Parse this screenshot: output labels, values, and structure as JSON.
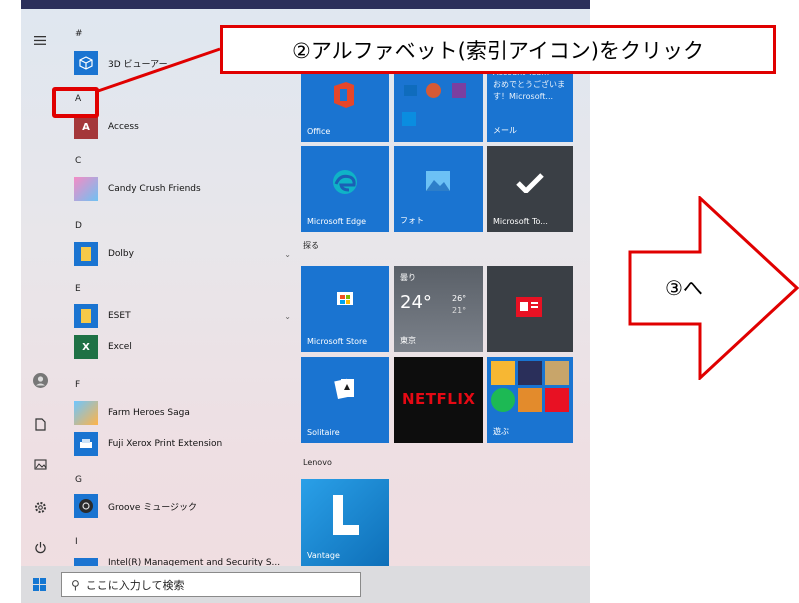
{
  "callout": {
    "text": "②アルファベット(索引アイコン)をクリック",
    "border_color": "#e00000"
  },
  "next_arrow": {
    "text": "③へ",
    "border_color": "#e00000"
  },
  "start_menu": {
    "rail_icons": [
      "hamburger-menu-icon",
      "user-account-icon",
      "documents-icon",
      "pictures-icon",
      "settings-icon",
      "power-icon"
    ],
    "app_list": {
      "headers": [
        "#",
        "A",
        "C",
        "D",
        "E",
        "F",
        "G",
        "I"
      ],
      "apps": [
        {
          "label": "3D ビューアー",
          "icon": "3d-viewer-icon"
        },
        {
          "label": "Access",
          "icon": "access-icon"
        },
        {
          "label": "Candy Crush Friends",
          "icon": "candy-crush-icon"
        },
        {
          "label": "Dolby",
          "icon": "folder-icon"
        },
        {
          "label": "ESET",
          "icon": "folder-icon"
        },
        {
          "label": "Excel",
          "icon": "excel-icon"
        },
        {
          "label": "Farm Heroes Saga",
          "icon": "farm-heroes-icon"
        },
        {
          "label": "Fuji Xerox Print Extension",
          "icon": "fuji-xerox-icon"
        },
        {
          "label": "Groove ミュージック",
          "icon": "groove-music-icon"
        },
        {
          "label": "Intel(R) Management and Security S...",
          "icon": "intel-icon"
        }
      ]
    },
    "tiles": {
      "office": "Office",
      "mail": "メール",
      "mail_notice": [
        "Account Team",
        "おめでとうございま",
        "す！Microsoft..."
      ],
      "edge": "Microsoft Edge",
      "photos": "フォト",
      "todo": "Microsoft To...",
      "group_explore": "探る",
      "store": "Microsoft Store",
      "weather_condition": "曇り",
      "weather_temp": "24°",
      "weather_high": "26°",
      "weather_low": "21°",
      "weather_city": "東京",
      "solitaire": "Solitaire",
      "netflix": "NETFLIX",
      "play": "遊ぶ",
      "group_lenovo": "Lenovo",
      "vantage": "Vantage"
    }
  },
  "taskbar": {
    "search_placeholder": "ここに入力して検索"
  },
  "colors": {
    "tile_blue": "#1a74d1",
    "tile_dark": "#353a40",
    "accent_red": "#e00000"
  }
}
